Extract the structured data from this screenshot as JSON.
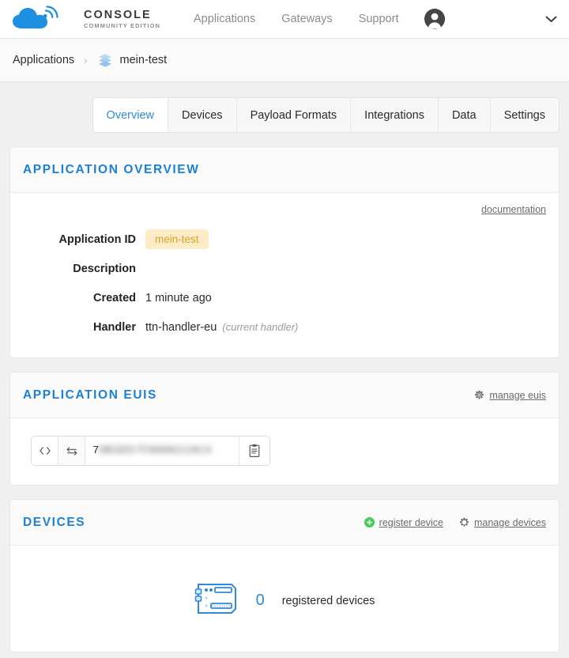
{
  "header": {
    "logo_icon": "cloud-signal-logo",
    "brand_title": "CONSOLE",
    "brand_subtitle": "COMMUNITY EDITION",
    "nav": [
      {
        "label": "Applications"
      },
      {
        "label": "Gateways"
      },
      {
        "label": "Support"
      }
    ],
    "avatar_icon": "user-avatar-icon",
    "dropdown_icon": "chevron-down-icon"
  },
  "breadcrumb": {
    "root_label": "Applications",
    "separator": "›",
    "app_icon": "application-stack-icon",
    "current_label": "mein-test"
  },
  "tabs": [
    {
      "label": "Overview",
      "active": true
    },
    {
      "label": "Devices",
      "active": false
    },
    {
      "label": "Payload Formats",
      "active": false
    },
    {
      "label": "Integrations",
      "active": false
    },
    {
      "label": "Data",
      "active": false
    },
    {
      "label": "Settings",
      "active": false
    }
  ],
  "overview": {
    "title": "APPLICATION OVERVIEW",
    "documentation_label": "documentation",
    "rows": {
      "application_id_label": "Application ID",
      "application_id_value": "mein-test",
      "description_label": "Description",
      "description_value": "",
      "created_label": "Created",
      "created_value": "1 minute ago",
      "handler_label": "Handler",
      "handler_value": "ttn-handler-eu",
      "handler_note": "(current handler)"
    }
  },
  "euis": {
    "title": "APPLICATION EUIS",
    "manage_label": "manage euis",
    "manage_icon": "gear-icon",
    "code_toggle_icon": "code-brackets-icon",
    "swap_icon": "byte-order-swap-icon",
    "copy_icon": "clipboard-copy-icon",
    "value_prefix": "7",
    "value_masked": "0B3D57F0000218C4"
  },
  "devices": {
    "title": "DEVICES",
    "register_label": "register device",
    "register_icon": "plus-circle-icon",
    "manage_label": "manage devices",
    "manage_icon": "gear-icon",
    "device_icon": "circuit-board-device-icon",
    "count": "0",
    "count_text": "registered devices"
  },
  "colors": {
    "brand_blue": "#1e80d2",
    "tab_active_blue": "#2f88d8",
    "badge_bg": "#fdecc6",
    "badge_text": "#d7a32a",
    "page_bg": "#f0f0f0",
    "green": "#44cc5a"
  }
}
